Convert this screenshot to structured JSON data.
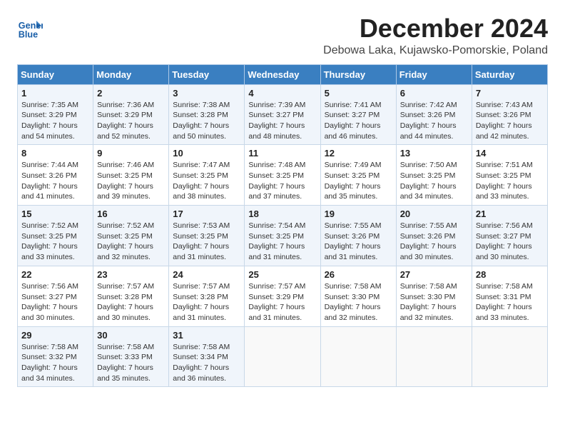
{
  "header": {
    "logo_text_general": "General",
    "logo_text_blue": "Blue",
    "month_title": "December 2024",
    "location": "Debowa Laka, Kujawsko-Pomorskie, Poland"
  },
  "weekdays": [
    "Sunday",
    "Monday",
    "Tuesday",
    "Wednesday",
    "Thursday",
    "Friday",
    "Saturday"
  ],
  "weeks": [
    [
      {
        "day": "1",
        "sunrise": "Sunrise: 7:35 AM",
        "sunset": "Sunset: 3:29 PM",
        "daylight": "Daylight: 7 hours and 54 minutes."
      },
      {
        "day": "2",
        "sunrise": "Sunrise: 7:36 AM",
        "sunset": "Sunset: 3:29 PM",
        "daylight": "Daylight: 7 hours and 52 minutes."
      },
      {
        "day": "3",
        "sunrise": "Sunrise: 7:38 AM",
        "sunset": "Sunset: 3:28 PM",
        "daylight": "Daylight: 7 hours and 50 minutes."
      },
      {
        "day": "4",
        "sunrise": "Sunrise: 7:39 AM",
        "sunset": "Sunset: 3:27 PM",
        "daylight": "Daylight: 7 hours and 48 minutes."
      },
      {
        "day": "5",
        "sunrise": "Sunrise: 7:41 AM",
        "sunset": "Sunset: 3:27 PM",
        "daylight": "Daylight: 7 hours and 46 minutes."
      },
      {
        "day": "6",
        "sunrise": "Sunrise: 7:42 AM",
        "sunset": "Sunset: 3:26 PM",
        "daylight": "Daylight: 7 hours and 44 minutes."
      },
      {
        "day": "7",
        "sunrise": "Sunrise: 7:43 AM",
        "sunset": "Sunset: 3:26 PM",
        "daylight": "Daylight: 7 hours and 42 minutes."
      }
    ],
    [
      {
        "day": "8",
        "sunrise": "Sunrise: 7:44 AM",
        "sunset": "Sunset: 3:26 PM",
        "daylight": "Daylight: 7 hours and 41 minutes."
      },
      {
        "day": "9",
        "sunrise": "Sunrise: 7:46 AM",
        "sunset": "Sunset: 3:25 PM",
        "daylight": "Daylight: 7 hours and 39 minutes."
      },
      {
        "day": "10",
        "sunrise": "Sunrise: 7:47 AM",
        "sunset": "Sunset: 3:25 PM",
        "daylight": "Daylight: 7 hours and 38 minutes."
      },
      {
        "day": "11",
        "sunrise": "Sunrise: 7:48 AM",
        "sunset": "Sunset: 3:25 PM",
        "daylight": "Daylight: 7 hours and 37 minutes."
      },
      {
        "day": "12",
        "sunrise": "Sunrise: 7:49 AM",
        "sunset": "Sunset: 3:25 PM",
        "daylight": "Daylight: 7 hours and 35 minutes."
      },
      {
        "day": "13",
        "sunrise": "Sunrise: 7:50 AM",
        "sunset": "Sunset: 3:25 PM",
        "daylight": "Daylight: 7 hours and 34 minutes."
      },
      {
        "day": "14",
        "sunrise": "Sunrise: 7:51 AM",
        "sunset": "Sunset: 3:25 PM",
        "daylight": "Daylight: 7 hours and 33 minutes."
      }
    ],
    [
      {
        "day": "15",
        "sunrise": "Sunrise: 7:52 AM",
        "sunset": "Sunset: 3:25 PM",
        "daylight": "Daylight: 7 hours and 33 minutes."
      },
      {
        "day": "16",
        "sunrise": "Sunrise: 7:52 AM",
        "sunset": "Sunset: 3:25 PM",
        "daylight": "Daylight: 7 hours and 32 minutes."
      },
      {
        "day": "17",
        "sunrise": "Sunrise: 7:53 AM",
        "sunset": "Sunset: 3:25 PM",
        "daylight": "Daylight: 7 hours and 31 minutes."
      },
      {
        "day": "18",
        "sunrise": "Sunrise: 7:54 AM",
        "sunset": "Sunset: 3:25 PM",
        "daylight": "Daylight: 7 hours and 31 minutes."
      },
      {
        "day": "19",
        "sunrise": "Sunrise: 7:55 AM",
        "sunset": "Sunset: 3:26 PM",
        "daylight": "Daylight: 7 hours and 31 minutes."
      },
      {
        "day": "20",
        "sunrise": "Sunrise: 7:55 AM",
        "sunset": "Sunset: 3:26 PM",
        "daylight": "Daylight: 7 hours and 30 minutes."
      },
      {
        "day": "21",
        "sunrise": "Sunrise: 7:56 AM",
        "sunset": "Sunset: 3:27 PM",
        "daylight": "Daylight: 7 hours and 30 minutes."
      }
    ],
    [
      {
        "day": "22",
        "sunrise": "Sunrise: 7:56 AM",
        "sunset": "Sunset: 3:27 PM",
        "daylight": "Daylight: 7 hours and 30 minutes."
      },
      {
        "day": "23",
        "sunrise": "Sunrise: 7:57 AM",
        "sunset": "Sunset: 3:28 PM",
        "daylight": "Daylight: 7 hours and 30 minutes."
      },
      {
        "day": "24",
        "sunrise": "Sunrise: 7:57 AM",
        "sunset": "Sunset: 3:28 PM",
        "daylight": "Daylight: 7 hours and 31 minutes."
      },
      {
        "day": "25",
        "sunrise": "Sunrise: 7:57 AM",
        "sunset": "Sunset: 3:29 PM",
        "daylight": "Daylight: 7 hours and 31 minutes."
      },
      {
        "day": "26",
        "sunrise": "Sunrise: 7:58 AM",
        "sunset": "Sunset: 3:30 PM",
        "daylight": "Daylight: 7 hours and 32 minutes."
      },
      {
        "day": "27",
        "sunrise": "Sunrise: 7:58 AM",
        "sunset": "Sunset: 3:30 PM",
        "daylight": "Daylight: 7 hours and 32 minutes."
      },
      {
        "day": "28",
        "sunrise": "Sunrise: 7:58 AM",
        "sunset": "Sunset: 3:31 PM",
        "daylight": "Daylight: 7 hours and 33 minutes."
      }
    ],
    [
      {
        "day": "29",
        "sunrise": "Sunrise: 7:58 AM",
        "sunset": "Sunset: 3:32 PM",
        "daylight": "Daylight: 7 hours and 34 minutes."
      },
      {
        "day": "30",
        "sunrise": "Sunrise: 7:58 AM",
        "sunset": "Sunset: 3:33 PM",
        "daylight": "Daylight: 7 hours and 35 minutes."
      },
      {
        "day": "31",
        "sunrise": "Sunrise: 7:58 AM",
        "sunset": "Sunset: 3:34 PM",
        "daylight": "Daylight: 7 hours and 36 minutes."
      },
      null,
      null,
      null,
      null
    ]
  ]
}
